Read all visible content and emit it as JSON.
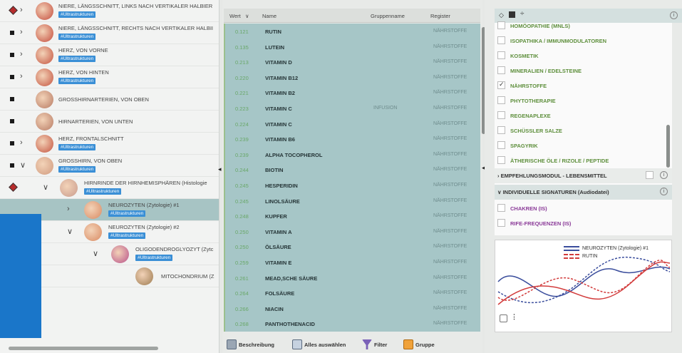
{
  "tree": {
    "tag": "#Ultrastrukturen",
    "rows": [
      {
        "label": "NIERE, LÄNGSSCHNITT, LINKS NACH VERTIKALER HALBIER",
        "tag": true,
        "thumb": "#c44a3b"
      },
      {
        "label": "NIERE, LÄNGSSCHNITT, RECHTS NACH VERTIKALER HALBII",
        "tag": true,
        "thumb": "#c44a3b"
      },
      {
        "label": "HERZ, VON VORNE",
        "tag": true,
        "thumb": "#c4533f"
      },
      {
        "label": "HERZ, VON HINTEN",
        "tag": true,
        "thumb": "#c4533f"
      },
      {
        "label": "GROSSHIRNARTERIEN, VON OBEN",
        "tag": false,
        "thumb": "#b77a63"
      },
      {
        "label": "HIRNARTERIEN, VON UNTEN",
        "tag": false,
        "thumb": "#b77a63"
      },
      {
        "label": "HERZ, FRONTALSCHNITT",
        "tag": true,
        "thumb": "#c4533f"
      },
      {
        "label": "GROSSHIRN, VON OBEN",
        "tag": true,
        "thumb": "#d09a7e"
      },
      {
        "label": "HIRNRINDE DER HIRNHEMISPHÄREN (Histologie",
        "tag": true,
        "thumb": "#c99b8d"
      },
      {
        "label": "NEUROZYTEN (Zytologie) #1",
        "tag": true,
        "thumb": "#d98a62"
      },
      {
        "label": "NEUROZYTEN (Zytologie) #2",
        "tag": true,
        "thumb": "#d98a62"
      },
      {
        "label": "OLIGODENDROGLYOZYT (Zytc",
        "tag": true,
        "thumb": "#b8518a"
      },
      {
        "label": "MITOCHONDRIUM (Z",
        "tag": false,
        "thumb": "#9c7a4f"
      }
    ]
  },
  "table": {
    "headers": {
      "wert": "Wert",
      "name": "Name",
      "gruppe": "Gruppenname",
      "register": "Register"
    },
    "rows": [
      {
        "wert": "0.121",
        "name": "RUTIN",
        "gruppe": "",
        "reg": "NÄHRSTOFFE"
      },
      {
        "wert": "0.135",
        "name": "LUTEIN",
        "gruppe": "",
        "reg": "NÄHRSTOFFE"
      },
      {
        "wert": "0.213",
        "name": "VITAMIN D",
        "gruppe": "",
        "reg": "NÄHRSTOFFE"
      },
      {
        "wert": "0.220",
        "name": "VITAMIN B12",
        "gruppe": "",
        "reg": "NÄHRSTOFFE"
      },
      {
        "wert": "0.221",
        "name": "VITAMIN B2",
        "gruppe": "",
        "reg": "NÄHRSTOFFE"
      },
      {
        "wert": "0.223",
        "name": "VITAMIN C",
        "gruppe": "INFUSION",
        "reg": "NÄHRSTOFFE"
      },
      {
        "wert": "0.224",
        "name": "VITAMIN C",
        "gruppe": "",
        "reg": "NÄHRSTOFFE"
      },
      {
        "wert": "0.239",
        "name": "VITAMIN B6",
        "gruppe": "",
        "reg": "NÄHRSTOFFE"
      },
      {
        "wert": "0.239",
        "name": "ALPHA TOCOPHEROL",
        "gruppe": "",
        "reg": "NÄHRSTOFFE"
      },
      {
        "wert": "0.244",
        "name": "BIOTIN",
        "gruppe": "",
        "reg": "NÄHRSTOFFE"
      },
      {
        "wert": "0.245",
        "name": "HESPERIDIN",
        "gruppe": "",
        "reg": "NÄHRSTOFFE"
      },
      {
        "wert": "0.245",
        "name": "LINOLSÄURE",
        "gruppe": "",
        "reg": "NÄHRSTOFFE"
      },
      {
        "wert": "0.248",
        "name": "KUPFER",
        "gruppe": "",
        "reg": "NÄHRSTOFFE"
      },
      {
        "wert": "0.250",
        "name": "VITAMIN A",
        "gruppe": "",
        "reg": "NÄHRSTOFFE"
      },
      {
        "wert": "0.250",
        "name": "ÖLSÄURE",
        "gruppe": "",
        "reg": "NÄHRSTOFFE"
      },
      {
        "wert": "0.259",
        "name": "VITAMIN E",
        "gruppe": "",
        "reg": "NÄHRSTOFFE"
      },
      {
        "wert": "0.261",
        "name": "MEAD,SCHE SÄURE",
        "gruppe": "",
        "reg": "NÄHRSTOFFE"
      },
      {
        "wert": "0.264",
        "name": "FOLSÄURE",
        "gruppe": "",
        "reg": "NÄHRSTOFFE"
      },
      {
        "wert": "0.266",
        "name": "NIACIN",
        "gruppe": "",
        "reg": "NÄHRSTOFFE"
      },
      {
        "wert": "0.268",
        "name": "PANTHOTHENACID",
        "gruppe": "",
        "reg": "NÄHRSTOFFE"
      }
    ]
  },
  "toolbar": {
    "beschreibung": "Beschreibung",
    "alles": "Alles auswählen",
    "filter": "Filter",
    "gruppe": "Gruppe"
  },
  "filters": {
    "items": [
      {
        "label": "HOMÖOPATHIE (MNLS)",
        "checked": false
      },
      {
        "label": "ISOPATHIKA / IMMUNMODULATOREN",
        "checked": false
      },
      {
        "label": "KOSMETIK",
        "checked": false
      },
      {
        "label": "MINERALIEN / EDELSTEINE",
        "checked": false
      },
      {
        "label": "NÄHRSTOFFE",
        "checked": true
      },
      {
        "label": "PHYTOTHERAPIE",
        "checked": false
      },
      {
        "label": "REGENAPLEXE",
        "checked": false
      },
      {
        "label": "SCHÜSSLER SALZE",
        "checked": false
      },
      {
        "label": "SPAGYRIK",
        "checked": false
      },
      {
        "label": "ÄTHERISCHE ÖLE / RIZOLE / PEPTIDE",
        "checked": false
      }
    ],
    "section1": "EMPFEHLUNGSMODUL - LEBENSMITTEL",
    "section2": "INDIVIDUELLE SIGNATUREN (Audiodatei)",
    "items2": [
      {
        "label": "CHAKREN (IS)"
      },
      {
        "label": "RIFE-FREQUENZEN (IS)"
      }
    ]
  },
  "chart_legend": {
    "series1": "NEUROZYTEN (Zytologie) #1",
    "series2": "RUTIN"
  },
  "colors": {
    "accent": "#1a76c9",
    "tag": "#3a8fd6",
    "series1": "#3a4d9c",
    "series2": "#d23b3b"
  }
}
